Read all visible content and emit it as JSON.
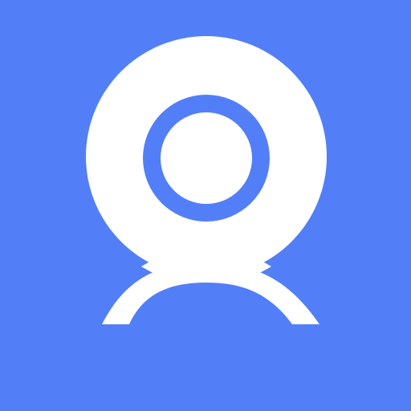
{
  "icon": {
    "name": "webcam-user-icon",
    "background_color": "#527ff8",
    "foreground_color": "#ffffff",
    "lens_color": "#527ff8"
  }
}
